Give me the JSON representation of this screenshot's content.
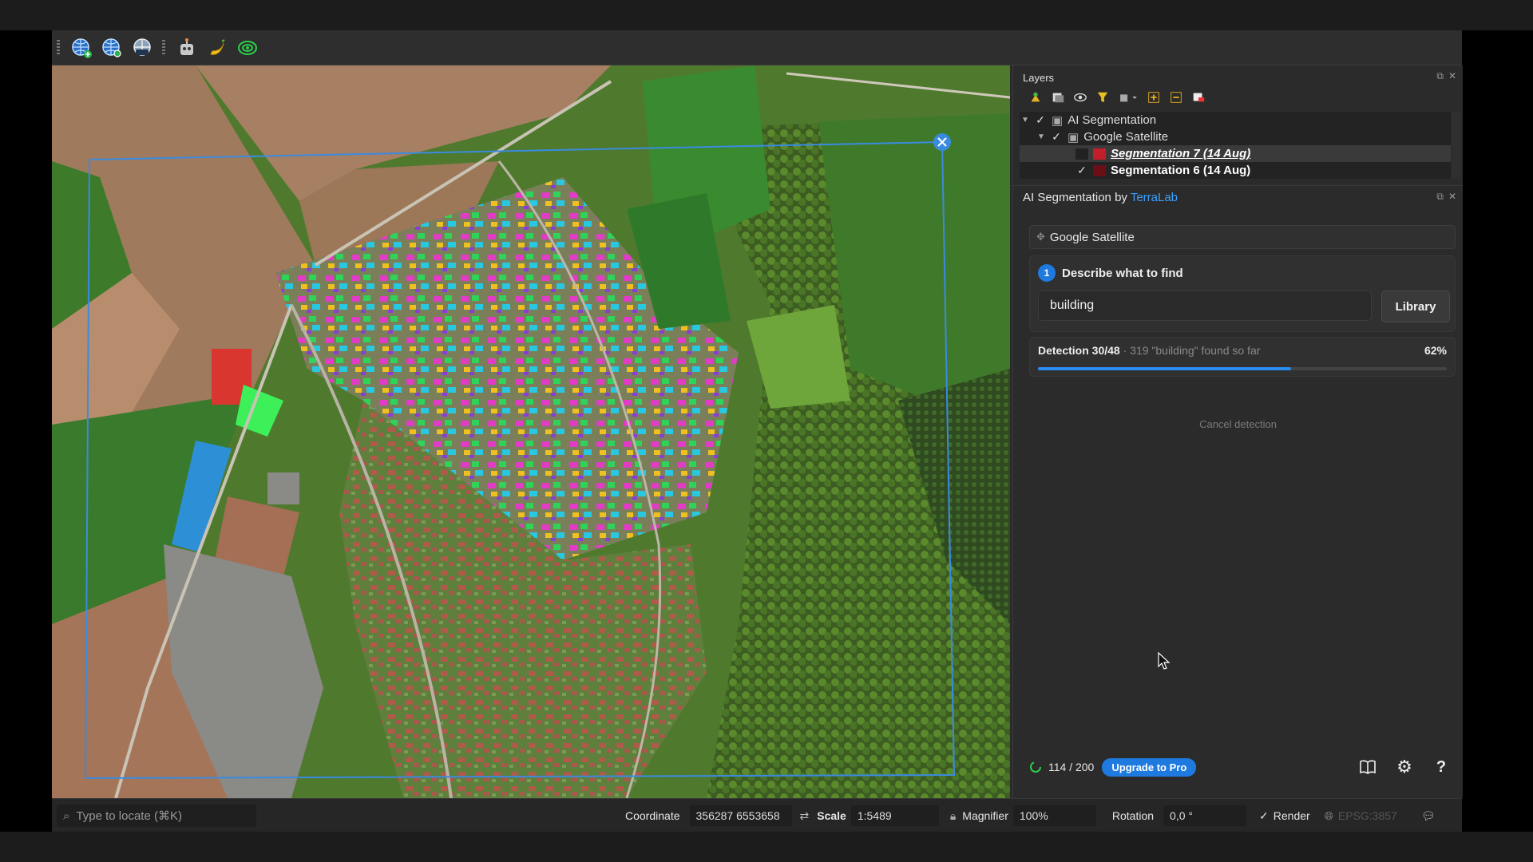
{
  "toolbar": {
    "icons": [
      "globe-add-icon",
      "globe-search-icon",
      "globe-layers-icon",
      "robot-icon",
      "banana-icon",
      "target-icon"
    ]
  },
  "layers_panel": {
    "title": "Layers",
    "tree": [
      {
        "label": "AI Segmentation",
        "checked": true,
        "expanded": true
      },
      {
        "label": "Google Satellite",
        "checked": true,
        "expanded": true
      },
      {
        "label": "Segmentation 7 (14 Aug)",
        "checked": false,
        "color": "#c21f2a"
      },
      {
        "label": "Segmentation 6 (14 Aug)",
        "checked": true,
        "color": "#6b0f16"
      }
    ]
  },
  "ai_panel": {
    "title_prefix": "AI Segmentation by ",
    "title_link": "TerraLab",
    "source_layer": "Google Satellite",
    "step_number": "1",
    "step_label": "Describe what to find",
    "prompt_value": "building",
    "library_button": "Library",
    "detection_label": "Detection 30/48",
    "detection_detail": " · 319 \"building\" found so far",
    "progress_text": "62%",
    "progress_value": 0.62,
    "cancel_label": "Cancel detection",
    "credits": "114 / 200",
    "upgrade_label": "Upgrade to Pro"
  },
  "statusbar": {
    "locate_placeholder": "Type to locate (⌘K)",
    "coordinate_label": "Coordinate",
    "coordinate_value": "356287  6553658",
    "scale_label": "Scale",
    "scale_value": "1:5489",
    "magnifier_label": "Magnifier",
    "magnifier_value": "100%",
    "rotation_label": "Rotation",
    "rotation_value": "0,0 °",
    "render_label": "Render",
    "crs_label": "EPSG:3857"
  },
  "colors": {
    "accent": "#1f7ae0",
    "link": "#3aa0ff",
    "selection_box": "#3a8be0"
  }
}
